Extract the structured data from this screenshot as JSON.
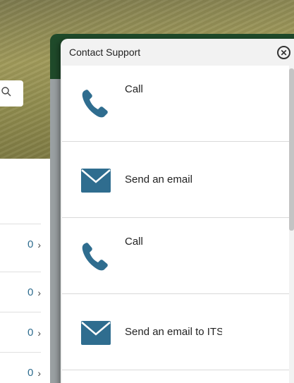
{
  "background": {
    "list_counts": [
      "0",
      "0",
      "0",
      "0"
    ],
    "search_icon": "search-icon",
    "chevron_icon": "chevron-right-icon"
  },
  "modal": {
    "title": "Contact Support",
    "close_icon": "close-circle-icon",
    "items": [
      {
        "label": "Call",
        "icon": "phone-icon"
      },
      {
        "label": "Send an email",
        "icon": "envelope-icon"
      },
      {
        "label": "Call",
        "icon": "phone-icon"
      },
      {
        "label": "Send an email to ITS",
        "icon": "envelope-icon"
      }
    ]
  },
  "colors": {
    "icon": "#2f6d8f",
    "panel_green": "#1f4a2a"
  }
}
